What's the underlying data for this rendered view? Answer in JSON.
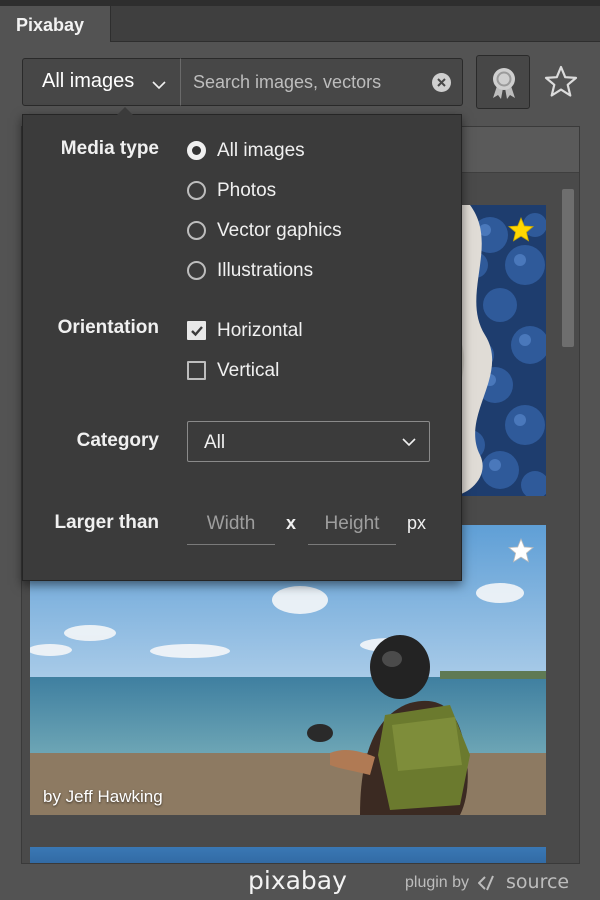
{
  "panel": {
    "tab_title": "Pixabay"
  },
  "toolbar": {
    "filter_label": "All images",
    "search_placeholder": "Search images, vectors",
    "search_value": "",
    "award_icon": "award-icon",
    "favorites_icon": "star-outline-icon"
  },
  "filters": {
    "media_type": {
      "label": "Media type",
      "options": [
        {
          "label": "All images",
          "selected": true
        },
        {
          "label": "Photos",
          "selected": false
        },
        {
          "label": "Vector gaphics",
          "selected": false
        },
        {
          "label": "Illustrations",
          "selected": false
        }
      ]
    },
    "orientation": {
      "label": "Orientation",
      "options": [
        {
          "label": "Horizontal",
          "checked": true
        },
        {
          "label": "Vertical",
          "checked": false
        }
      ]
    },
    "category": {
      "label": "Category",
      "selected": "All"
    },
    "size": {
      "label": "Larger than",
      "width_placeholder": "Width",
      "height_placeholder": "Height",
      "times": "x",
      "unit": "px"
    }
  },
  "results": [
    {
      "favorited": true,
      "star_color": "#ffd700"
    },
    {
      "favorited": false,
      "credit": "by Jeff Hawking",
      "star_color": "#ffffff"
    }
  ],
  "footer": {
    "logo": "pixabay",
    "plugin_by": "plugin by",
    "source_brand": "source"
  },
  "colors": {
    "panel_bg": "#535353",
    "dropdown_bg": "#3b3b3b",
    "text": "#f0f0f0"
  }
}
